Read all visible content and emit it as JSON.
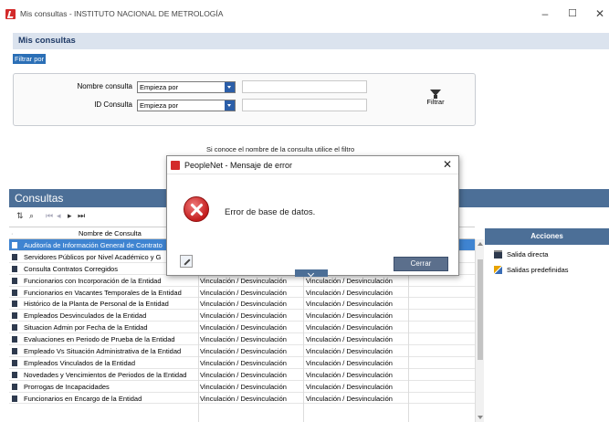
{
  "window": {
    "title": "Mis consultas - INSTITUTO NACIONAL DE METROLOGÍA",
    "controls": {
      "minimize": "–",
      "maximize": "☐",
      "close": "✕"
    }
  },
  "header": {
    "title": "Mis consultas",
    "filter_tab": "Filtrar por"
  },
  "filter": {
    "nombre_label": "Nombre consulta",
    "nombre_operator": "Empieza por",
    "nombre_value": "",
    "id_label": "ID Consulta",
    "id_operator": "Empieza por",
    "id_value": "",
    "filtrar_label": "Filtrar"
  },
  "hint": "Si conoce el nombre de la consulta utilice el filtro",
  "consultas": {
    "title": "Consultas",
    "column_header": "Nombre de Consulta",
    "rows": [
      {
        "name": "Auditoría de Información General de Contrato",
        "col2": "",
        "col3": ""
      },
      {
        "name": "Servidores Públicos por Nivel Académico y G",
        "col2": "",
        "col3": ""
      },
      {
        "name": "Consulta Contratos Corregidos",
        "col2": "",
        "col3": ""
      },
      {
        "name": "Funcionarios con Incorporación de la Entidad",
        "col2": "Vinculación / Desvinculación",
        "col3": "Vinculación / Desvinculación"
      },
      {
        "name": "Funcionarios en Vacantes Temporales de la Entidad",
        "col2": "Vinculación / Desvinculación",
        "col3": "Vinculación / Desvinculación"
      },
      {
        "name": "Histórico de la Planta de Personal de la Entidad",
        "col2": "Vinculación / Desvinculación",
        "col3": "Vinculación / Desvinculación"
      },
      {
        "name": "Empleados Desvinculados de la Entidad",
        "col2": "Vinculación / Desvinculación",
        "col3": "Vinculación / Desvinculación"
      },
      {
        "name": "Situacion Admin por Fecha de la Entidad",
        "col2": "Vinculación / Desvinculación",
        "col3": "Vinculación / Desvinculación"
      },
      {
        "name": "Evaluaciones en Periodo de Prueba de la Entidad",
        "col2": "Vinculación / Desvinculación",
        "col3": "Vinculación / Desvinculación"
      },
      {
        "name": "Empleado Vs Situación Administrativa de la Entidad",
        "col2": "Vinculación / Desvinculación",
        "col3": "Vinculación / Desvinculación"
      },
      {
        "name": "Empleados Vinculados de la Entidad",
        "col2": "Vinculación / Desvinculación",
        "col3": "Vinculación / Desvinculación"
      },
      {
        "name": "Novedades y Vencimientos de Periodos de la Entidad",
        "col2": "Vinculación / Desvinculación",
        "col3": "Vinculación / Desvinculación"
      },
      {
        "name": "Prorrogas de Incapacidades",
        "col2": "Vinculación / Desvinculación",
        "col3": "Vinculación / Desvinculación"
      },
      {
        "name": "Funcionarios en Encargo de la Entidad",
        "col2": "Vinculación / Desvinculación",
        "col3": "Vinculación / Desvinculación"
      }
    ]
  },
  "acciones": {
    "title": "Acciones",
    "items": [
      {
        "label": "Salida directa",
        "icon": "document-icon"
      },
      {
        "label": "Salidas predefinidas",
        "icon": "tools-icon"
      }
    ]
  },
  "dialog": {
    "title": "PeopleNet - Mensaje de error",
    "message": "Error de base de datos.",
    "close_button": "Cerrar",
    "icon": "error-icon"
  },
  "colors": {
    "selection": "#3f84d1",
    "panel_header": "#4c6f97",
    "filter_tab": "#2b6fb6",
    "error": "#c31d1d"
  }
}
